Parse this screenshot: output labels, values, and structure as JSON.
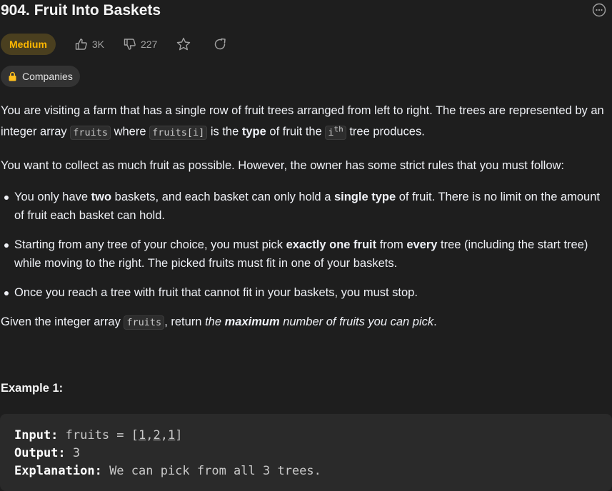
{
  "problem": {
    "title": "904. Fruit Into Baskets",
    "difficulty": "Medium",
    "likes": "3K",
    "dislikes": "227",
    "companies_label": "Companies"
  },
  "description": {
    "p1_a": "You are visiting a farm that has a single row of fruit trees arranged from left to right. The trees are represented by an integer array ",
    "p1_code1": "fruits",
    "p1_b": " where ",
    "p1_code2": "fruits[i]",
    "p1_c": " is the ",
    "p1_bold": "type",
    "p1_d": " of fruit the ",
    "p1_code3": "i",
    "p1_sup": "th",
    "p1_e": " tree produces.",
    "p2": "You want to collect as much fruit as possible. However, the owner has some strict rules that you must follow:",
    "rule1_a": "You only have ",
    "rule1_b1": "two",
    "rule1_b": " baskets, and each basket can only hold a ",
    "rule1_b2": "single type",
    "rule1_c": " of fruit. There is no limit on the amount of fruit each basket can hold.",
    "rule2_a": "Starting from any tree of your choice, you must pick ",
    "rule2_b1": "exactly one fruit",
    "rule2_b": " from ",
    "rule2_b2": "every",
    "rule2_c": " tree (including the start tree) while moving to the right. The picked fruits must fit in one of your baskets.",
    "rule3": "Once you reach a tree with fruit that cannot fit in your baskets, you must stop.",
    "p3_a": "Given the integer array ",
    "p3_code": "fruits",
    "p3_b": ", return ",
    "p3_i1": "the ",
    "p3_bi": "maximum",
    "p3_i2": " number of fruits you can pick",
    "p3_c": "."
  },
  "example": {
    "title": "Example 1:",
    "input_label": "Input:",
    "input_text": " fruits = [",
    "input_v1": "1",
    "input_v2": "2",
    "input_v3": "1",
    "input_end": "]",
    "output_label": "Output:",
    "output_value": " 3",
    "explanation_label": "Explanation:",
    "explanation_text": " We can pick from all 3 trees."
  },
  "colors": {
    "background": "#1e1e1e",
    "medium": "#ffb800",
    "muted": "#a1a1a1"
  }
}
